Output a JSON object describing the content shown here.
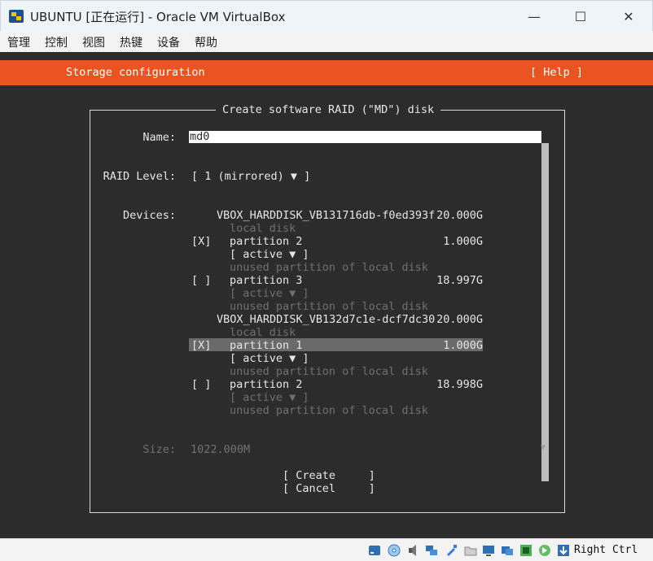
{
  "window": {
    "title": "UBUNTU [正在运行] - Oracle VM VirtualBox",
    "minimize_icon": "—",
    "maximize_icon": "☐",
    "close_icon": "✕"
  },
  "menu": [
    "管理",
    "控制",
    "视图",
    "热键",
    "设备",
    "帮助"
  ],
  "installer": {
    "header_title": "Storage configuration",
    "help_label": "[ Help ]",
    "dialog_title": "Create software RAID (\"MD\") disk",
    "name_label": "Name:",
    "name_value": "md0",
    "raid_label": "RAID Level:",
    "raid_value": "[ 1 (mirrored) ▼ ]",
    "devices_label": "Devices:",
    "disks": [
      {
        "name": "VBOX_HARDDISK_VB131716db-f0ed393f",
        "size": "20.000G",
        "desc": "local disk",
        "partitions": [
          {
            "check": "[X]",
            "name": "partition 2",
            "size": "1.000G",
            "action": "[ active ▼ ]",
            "action_dim": false,
            "desc": "unused partition of local disk"
          },
          {
            "check": "[ ]",
            "name": "partition 3",
            "size": "18.997G",
            "action": "[ active ▼ ]",
            "action_dim": true,
            "desc": "unused partition of local disk"
          }
        ]
      },
      {
        "name": "VBOX_HARDDISK_VB132d7c1e-dcf7dc30",
        "size": "20.000G",
        "desc": "local disk",
        "partitions": [
          {
            "check": "[X]",
            "name": "partition 1",
            "size": "1.000G",
            "action": "[ active ▼ ]",
            "action_dim": false,
            "desc": "unused partition of local disk"
          },
          {
            "check": "[ ]",
            "name": "partition 2",
            "size": "18.998G",
            "action": "[ active ▼ ]",
            "action_dim": true,
            "desc": "unused partition of local disk"
          }
        ]
      }
    ],
    "size_label": "Size:",
    "size_value": "1022.000M",
    "scroll_indicator": "▼",
    "create_button": "[ Create     ]",
    "cancel_button": "[ Cancel     ]"
  },
  "statusbar": {
    "host_key": "Right Ctrl",
    "icons": [
      "hdd-icon",
      "optical-disc-icon",
      "audio-icon",
      "network-icon",
      "usb-icon",
      "shared-folders-icon",
      "display-icon",
      "video-capture-icon",
      "virtualization-icon",
      "mouse-integration-icon",
      "keyboard-capture-icon"
    ]
  },
  "colors": {
    "ubuntu_orange": "#e95420",
    "terminal_bg": "#2c2c2c",
    "highlight_row": "#6a6a6a"
  }
}
